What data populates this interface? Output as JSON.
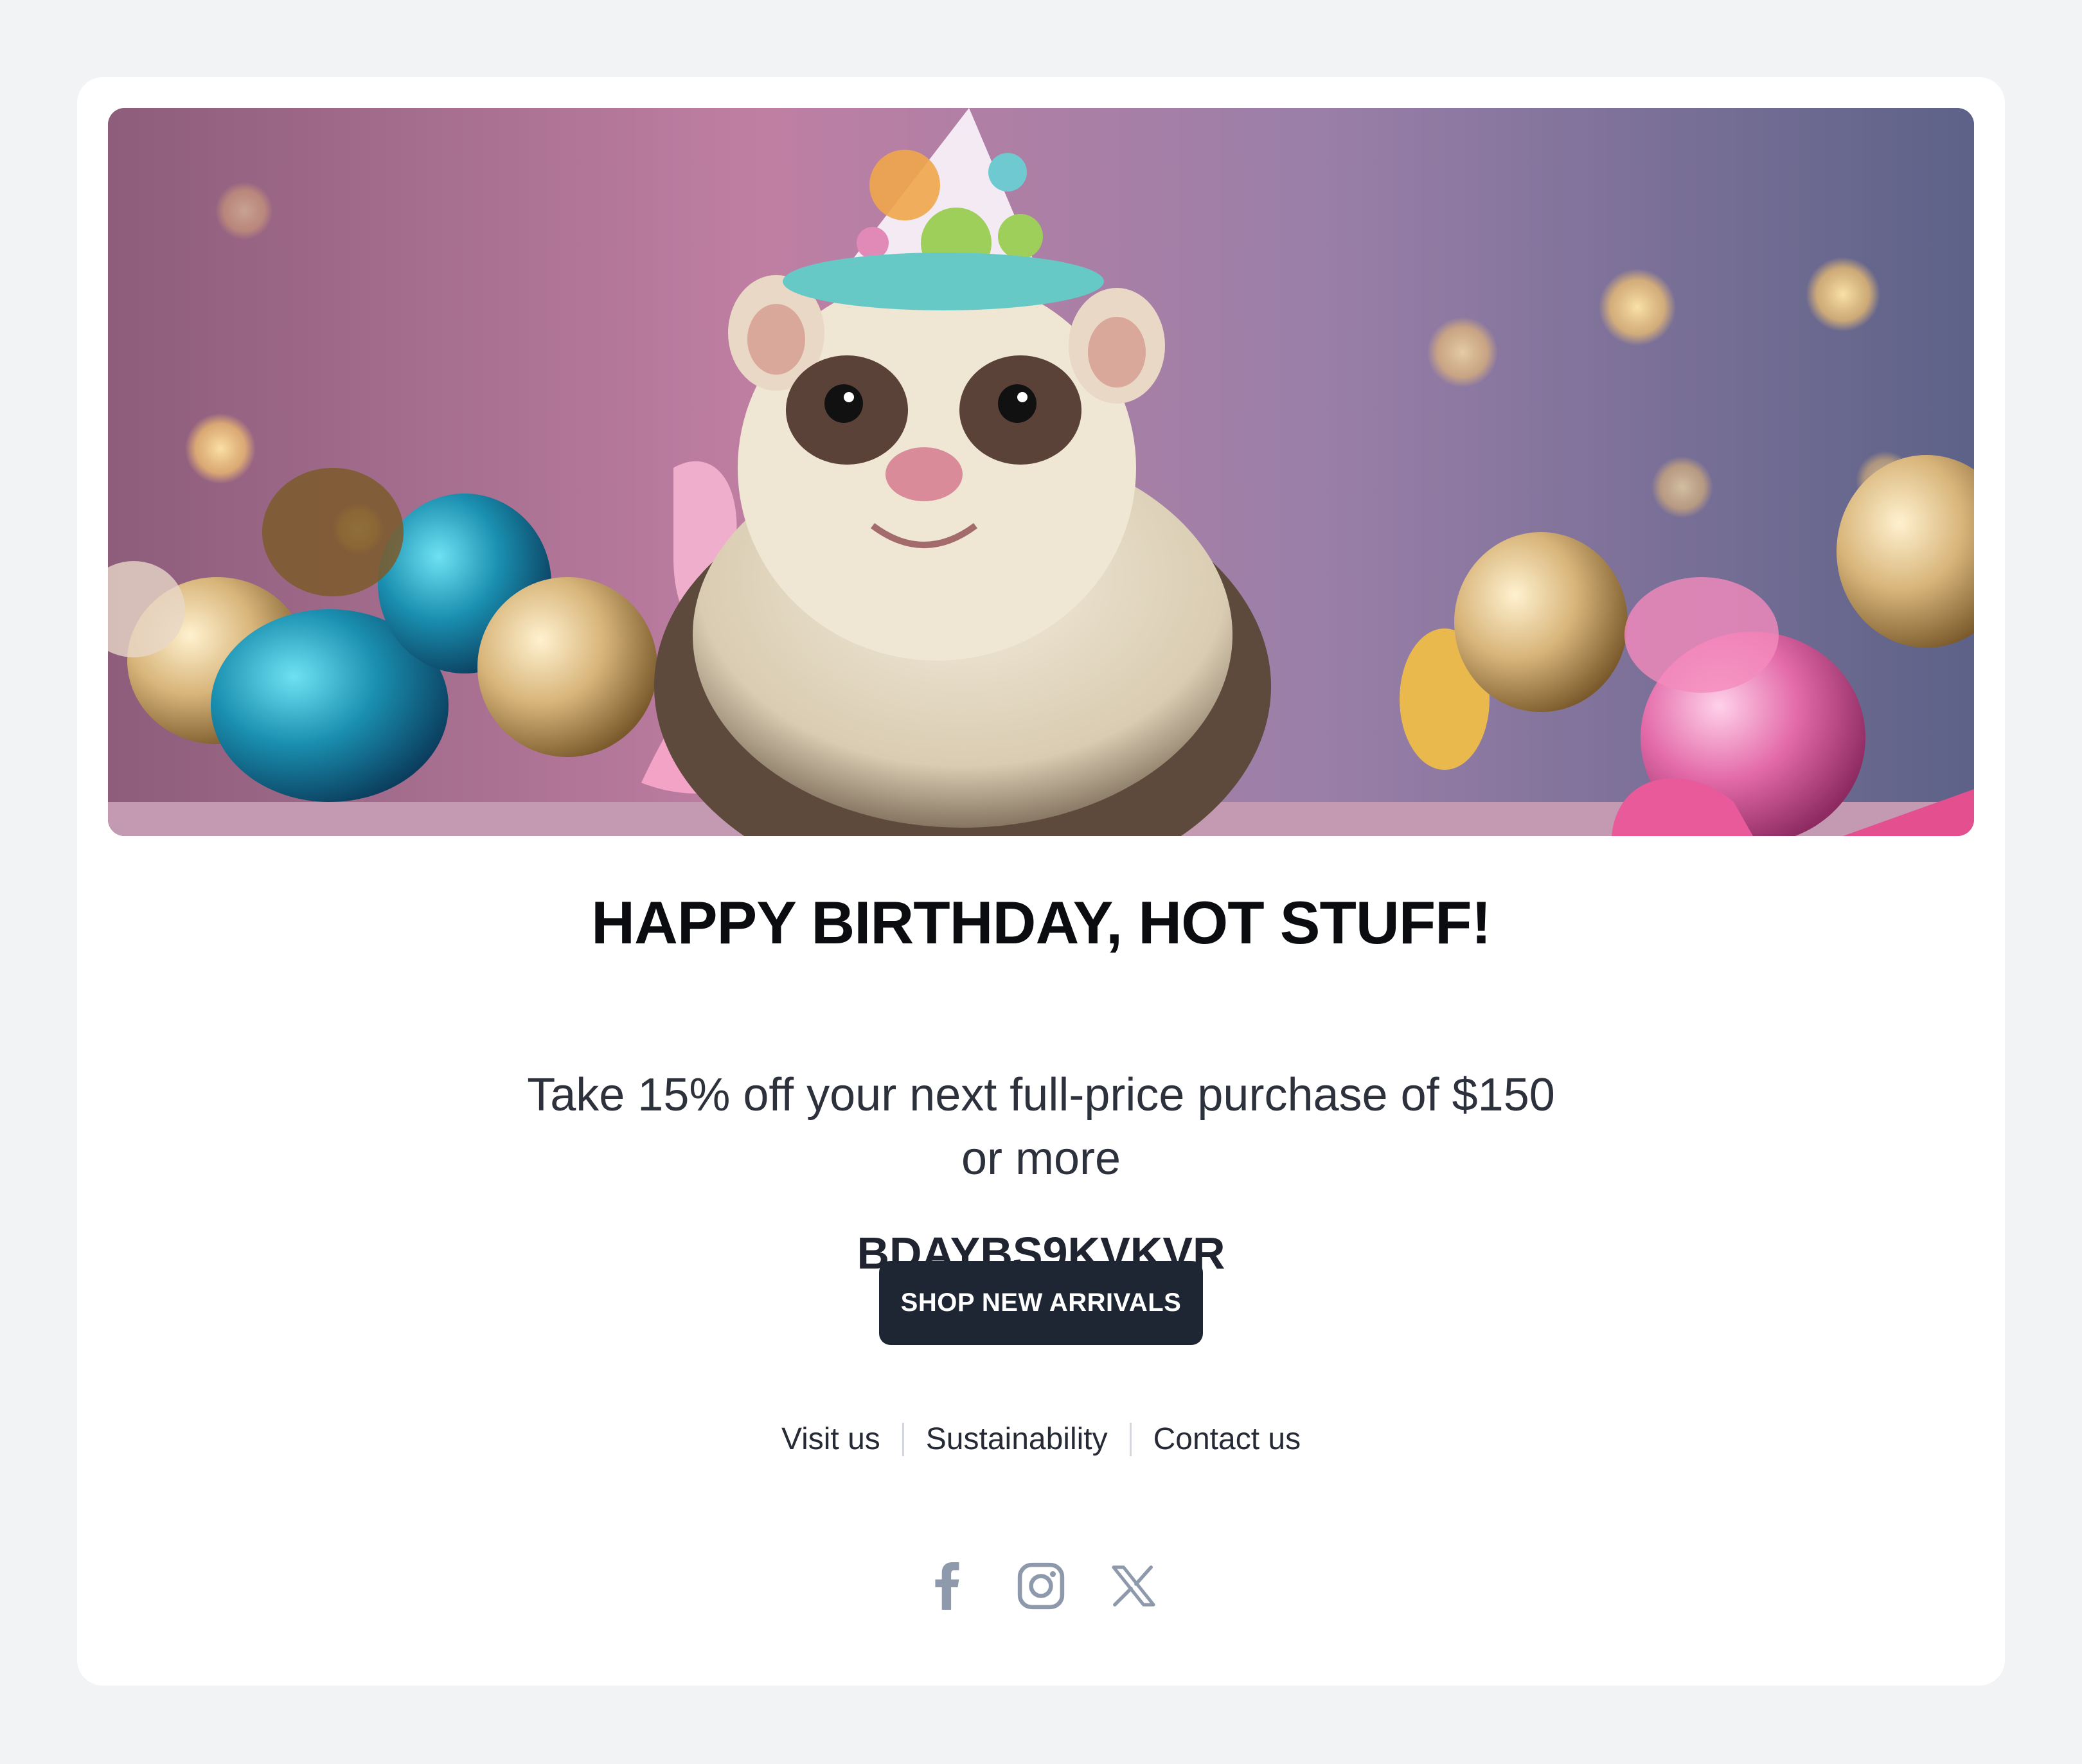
{
  "email": {
    "hero_image": "ferret-in-party-hat",
    "headline": "HAPPY BIRTHDAY, HOT STUFF!",
    "offer": "Take 15% off your next full-price purchase of $150 or more",
    "promo_code": "BDAYBS9KVKVR",
    "cta_label": "SHOP NEW ARRIVALS"
  },
  "footer": {
    "links": [
      "Visit us",
      "Sustainability",
      "Contact us"
    ],
    "social": [
      "facebook-icon",
      "instagram-icon",
      "x-icon"
    ]
  },
  "colors": {
    "page_bg": "#f2f3f5",
    "card_bg": "#ffffff",
    "button_bg": "#1e2533",
    "icon_color": "#8e99ac"
  }
}
